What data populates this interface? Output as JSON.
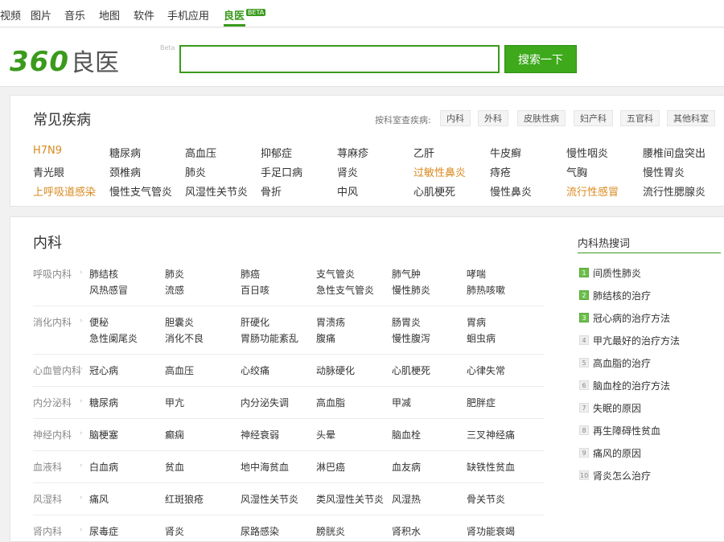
{
  "topnav": {
    "items": [
      "视频",
      "图片",
      "音乐",
      "地图",
      "软件",
      "手机应用",
      "良医"
    ],
    "active_badge": "BETA"
  },
  "header": {
    "logo_num": "360",
    "logo_text": "良医",
    "logo_beta": "Beta",
    "search_value": "",
    "search_button": "搜索一下"
  },
  "common": {
    "title": "常见疾病",
    "dept_label": "按科室查疾病:",
    "dept_tags": [
      "内科",
      "外科",
      "皮肤性病",
      "妇产科",
      "五官科",
      "其他科室"
    ],
    "diseases": [
      [
        "H7N9",
        "糖尿病",
        "高血压",
        "抑郁症",
        "荨麻疹",
        "乙肝",
        "牛皮癣",
        "慢性咽炎",
        "腰椎间盘突出"
      ],
      [
        "青光眼",
        "颈椎病",
        "肺炎",
        "手足口病",
        "肾炎",
        "过敏性鼻炎",
        "痔疮",
        "气胸",
        "慢性胃炎"
      ],
      [
        "上呼吸道感染",
        "慢性支气管炎",
        "风湿性关节炎",
        "骨折",
        "中风",
        "心肌梗死",
        "慢性鼻炎",
        "流行性感冒",
        "流行性腮腺炎"
      ]
    ],
    "hot_color": "#d98a1f"
  },
  "internal": {
    "title": "内科",
    "categories": [
      {
        "name": "呼吸内科",
        "rows": [
          [
            "肺结核",
            "肺炎",
            "肺癌",
            "支气管炎",
            "肺气肿",
            "哮喘"
          ],
          [
            "风热感冒",
            "流感",
            "百日咳",
            "急性支气管炎",
            "慢性肺炎",
            "肺热咳嗽"
          ]
        ]
      },
      {
        "name": "消化内科",
        "rows": [
          [
            "便秘",
            "胆囊炎",
            "肝硬化",
            "胃溃疡",
            "肠胃炎",
            "胃病"
          ],
          [
            "急性阑尾炎",
            "消化不良",
            "胃肠功能紊乱",
            "腹痛",
            "慢性腹泻",
            "蛔虫病"
          ]
        ]
      },
      {
        "name": "心血管内科",
        "rows": [
          [
            "冠心病",
            "高血压",
            "心绞痛",
            "动脉硬化",
            "心肌梗死",
            "心律失常"
          ]
        ]
      },
      {
        "name": "内分泌科",
        "rows": [
          [
            "糖尿病",
            "甲亢",
            "内分泌失调",
            "高血脂",
            "甲减",
            "肥胖症"
          ]
        ]
      },
      {
        "name": "神经内科",
        "rows": [
          [
            "脑梗塞",
            "癫痫",
            "神经衰弱",
            "头晕",
            "脑血栓",
            "三叉神经痛"
          ]
        ]
      },
      {
        "name": "血液科",
        "rows": [
          [
            "白血病",
            "贫血",
            "地中海贫血",
            "淋巴癌",
            "血友病",
            "缺铁性贫血"
          ]
        ]
      },
      {
        "name": "风湿科",
        "rows": [
          [
            "痛风",
            "红斑狼疮",
            "风湿性关节炎",
            "类风湿性关节炎",
            "风湿热",
            "骨关节炎"
          ]
        ]
      },
      {
        "name": "肾内科",
        "rows": [
          [
            "尿毒症",
            "肾炎",
            "尿路感染",
            "膀胱炎",
            "肾积水",
            "肾功能衰竭"
          ]
        ]
      }
    ],
    "hot_search": {
      "title": "内科热搜词",
      "items": [
        {
          "rank": "1",
          "text": "间质性肺炎"
        },
        {
          "rank": "2",
          "text": "肺结核的治疗"
        },
        {
          "rank": "3",
          "text": "冠心病的治疗方法"
        },
        {
          "rank": "4",
          "text": "甲亢最好的治疗方法"
        },
        {
          "rank": "5",
          "text": "高血脂的治疗"
        },
        {
          "rank": "6",
          "text": "脑血栓的治疗方法"
        },
        {
          "rank": "7",
          "text": "失眠的原因"
        },
        {
          "rank": "8",
          "text": "再生障碍性贫血"
        },
        {
          "rank": "9",
          "text": "痛风的原因"
        },
        {
          "rank": "10",
          "text": "肾炎怎么治疗"
        }
      ]
    },
    "accent_color": "#3a9a1c"
  }
}
